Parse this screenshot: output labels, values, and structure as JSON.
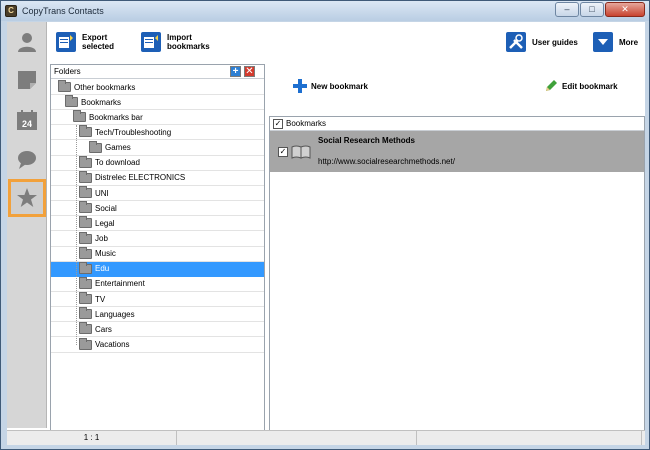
{
  "window": {
    "title": "CopyTrans Contacts",
    "app_icon": "C",
    "controls": [
      "–",
      "□",
      "✕"
    ]
  },
  "nav": {
    "items": [
      {
        "name": "contacts",
        "icon": "person-icon"
      },
      {
        "name": "notes",
        "icon": "note-icon"
      },
      {
        "name": "calendar",
        "icon": "calendar-icon",
        "label": "24"
      },
      {
        "name": "messages",
        "icon": "speech-bubble-icon"
      },
      {
        "name": "bookmarks",
        "icon": "star-icon",
        "active": true
      }
    ]
  },
  "toolbar": {
    "export_line1": "Export",
    "export_line2": "selected",
    "import_line1": "Import",
    "import_line2": "bookmarks",
    "user_guides": "User guides",
    "more": "More"
  },
  "folders": {
    "header": "Folders",
    "add": "+",
    "delete": "✕",
    "tree": [
      {
        "label": "Other bookmarks",
        "level": 0
      },
      {
        "label": "Bookmarks",
        "level": 1
      },
      {
        "label": "Bookmarks bar",
        "level": 2
      },
      {
        "label": "Tech/Troubleshooting",
        "level": 3
      },
      {
        "label": "Games",
        "level": 4
      },
      {
        "label": "To download",
        "level": 3
      },
      {
        "label": "Distrelec ELECTRONICS",
        "level": 3
      },
      {
        "label": "UNI",
        "level": 3
      },
      {
        "label": "Social",
        "level": 3
      },
      {
        "label": "Legal",
        "level": 3
      },
      {
        "label": "Job",
        "level": 3
      },
      {
        "label": "Music",
        "level": 3
      },
      {
        "label": "Edu",
        "level": 3,
        "selected": true
      },
      {
        "label": "Entertainment",
        "level": 3
      },
      {
        "label": "TV",
        "level": 3
      },
      {
        "label": "Languages",
        "level": 3
      },
      {
        "label": "Cars",
        "level": 3
      },
      {
        "label": "Vacations",
        "level": 3
      }
    ]
  },
  "bookmarks": {
    "new_bookmark": "New bookmark",
    "edit_bookmark": "Edit bookmark",
    "header": "Bookmarks",
    "items": [
      {
        "title": "Social Research Methods",
        "url": "http://www.socialresearchmethods.net/",
        "checked": true
      }
    ]
  },
  "status": {
    "count": "1 : 1"
  },
  "colors": {
    "accent_orange": "#f2a13b",
    "selection_blue": "#3399ff",
    "toolbar_blue": "#1d5fb6"
  }
}
